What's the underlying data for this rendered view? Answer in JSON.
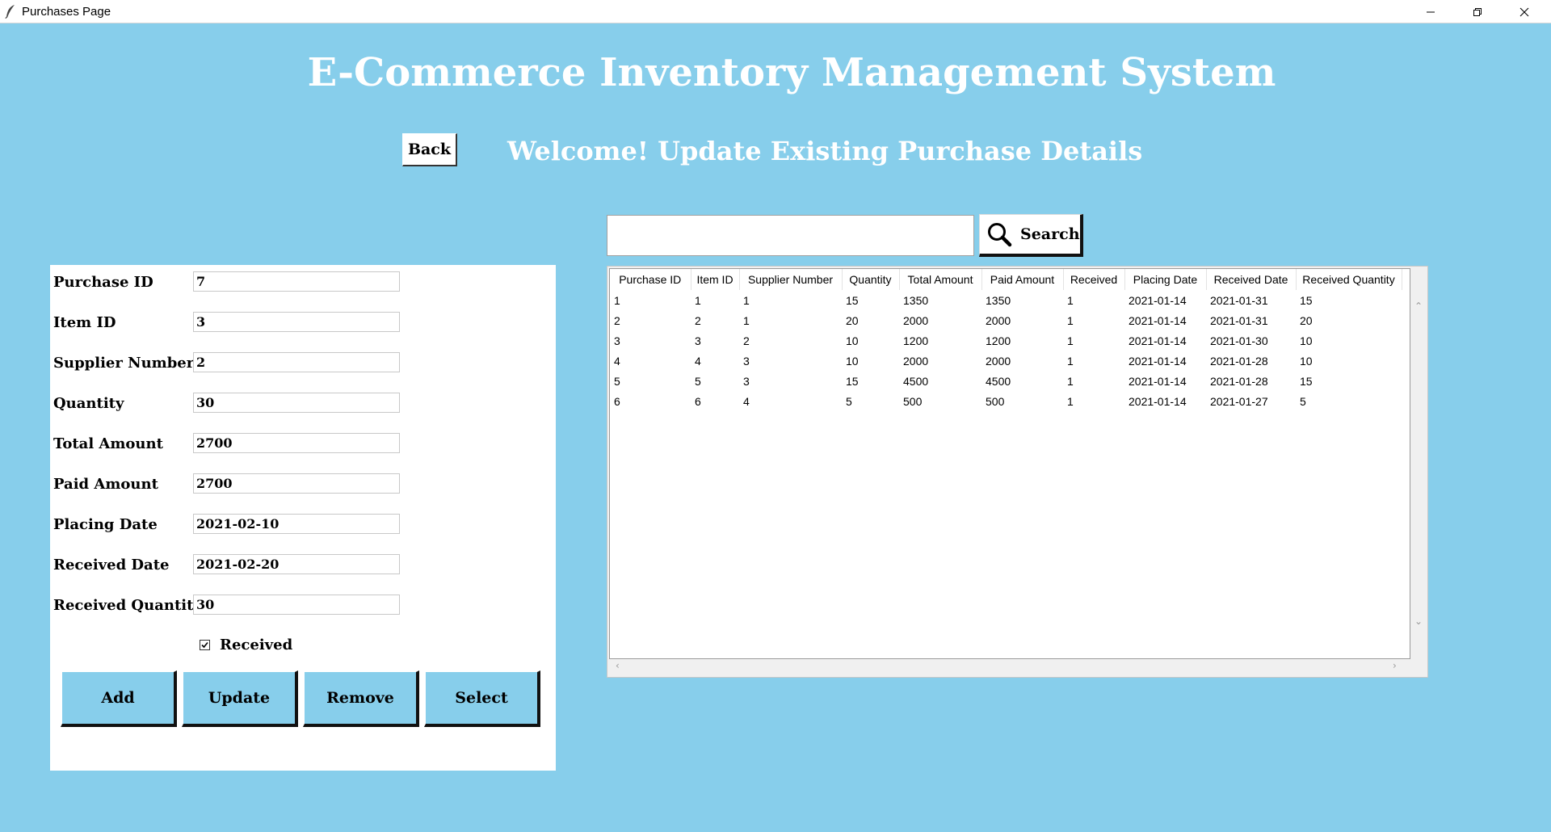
{
  "window": {
    "title": "Purchases Page"
  },
  "header": {
    "main_title": "E-Commerce Inventory Management System",
    "sub_title": "Welcome! Update Existing Purchase Details",
    "back_label": "Back"
  },
  "form": {
    "fields": [
      {
        "label": "Purchase ID",
        "value": "7"
      },
      {
        "label": "Item ID",
        "value": "3"
      },
      {
        "label": "Supplier Number",
        "value": "2"
      },
      {
        "label": "Quantity",
        "value": "30"
      },
      {
        "label": "Total Amount",
        "value": "2700"
      },
      {
        "label": "Paid Amount",
        "value": "2700"
      },
      {
        "label": "Placing Date",
        "value": "2021-02-10"
      },
      {
        "label": "Received Date",
        "value": "2021-02-20"
      },
      {
        "label": "Received Quantity",
        "value": "30"
      }
    ],
    "received_label": "Received",
    "received_checked": true,
    "buttons": {
      "add": "Add",
      "update": "Update",
      "remove": "Remove",
      "select": "Select"
    }
  },
  "search": {
    "value": "",
    "button_label": "Search"
  },
  "table": {
    "columns": [
      "Purchase ID",
      "Item ID",
      "Supplier Number",
      "Quantity",
      "Total Amount",
      "Paid Amount",
      "Received",
      "Placing Date",
      "Received Date",
      "Received Quantity"
    ],
    "rows": [
      [
        "1",
        "1",
        "1",
        "15",
        "1350",
        "1350",
        "1",
        "2021-01-14",
        "2021-01-31",
        "15"
      ],
      [
        "2",
        "2",
        "1",
        "20",
        "2000",
        "2000",
        "1",
        "2021-01-14",
        "2021-01-31",
        "20"
      ],
      [
        "3",
        "3",
        "2",
        "10",
        "1200",
        "1200",
        "1",
        "2021-01-14",
        "2021-01-30",
        "10"
      ],
      [
        "4",
        "4",
        "3",
        "10",
        "2000",
        "2000",
        "1",
        "2021-01-14",
        "2021-01-28",
        "10"
      ],
      [
        "5",
        "5",
        "3",
        "15",
        "4500",
        "4500",
        "1",
        "2021-01-14",
        "2021-01-28",
        "15"
      ],
      [
        "6",
        "6",
        "4",
        "5",
        "500",
        "500",
        "1",
        "2021-01-14",
        "2021-01-27",
        "5"
      ]
    ]
  }
}
